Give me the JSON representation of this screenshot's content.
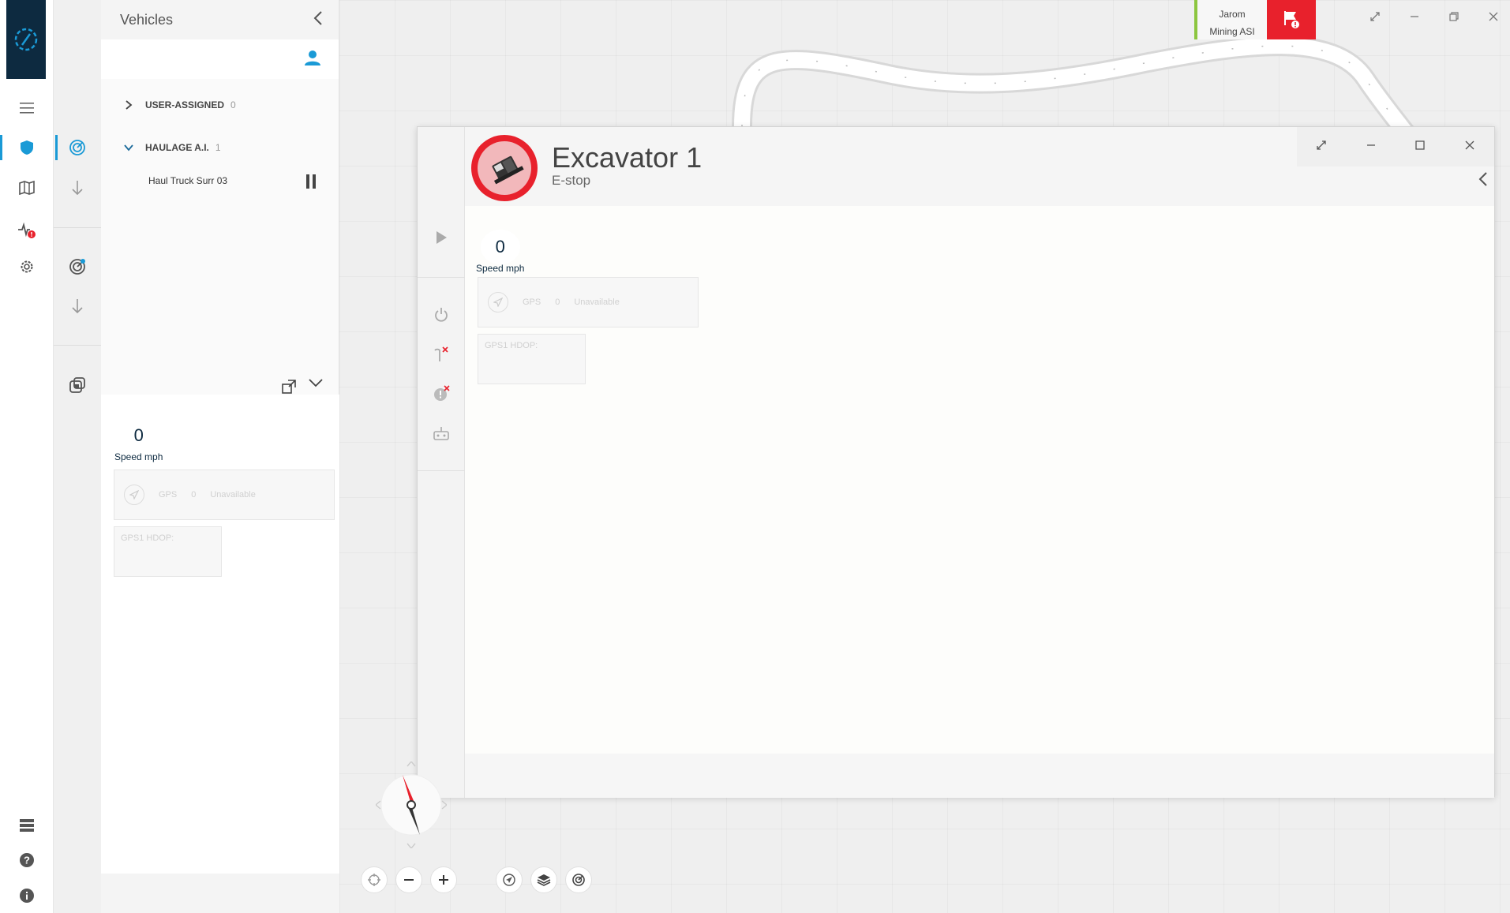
{
  "panel": {
    "title": "Vehicles",
    "groups": [
      {
        "label": "USER-ASSIGNED",
        "count": "0",
        "expanded": false
      },
      {
        "label": "HAULAGE A.I.",
        "count": "1",
        "expanded": true
      }
    ],
    "vehicles": [
      {
        "label": "Haul Truck Surr 03",
        "state": "paused"
      }
    ],
    "telemetry": {
      "speed_value": "0",
      "speed_label": "Speed mph",
      "gps_label": "GPS",
      "gps_value": "0",
      "gps_status": "Unavailable",
      "hdop_label": "GPS1 HDOP:"
    }
  },
  "user": {
    "name": "Jarom",
    "org": "Mining ASI"
  },
  "dialog": {
    "title": "Excavator 1",
    "subtitle": "E-stop",
    "telemetry": {
      "speed_value": "0",
      "speed_label": "Speed mph",
      "gps_label": "GPS",
      "gps_value": "0",
      "gps_status": "Unavailable",
      "hdop_label": "GPS1 HDOP:"
    }
  },
  "colors": {
    "accent": "#1a9ad6",
    "alert": "#e8212c",
    "nav_dark": "#0d2a40",
    "status_green": "#8cc63f"
  },
  "icons": {
    "rail": [
      "hamburger-menu-icon",
      "shield-icon",
      "map-icon",
      "activity-alert-icon",
      "gear-icon",
      "server-icon",
      "help-icon",
      "info-icon"
    ],
    "rail2": [
      "radar-icon",
      "arrow-down-icon",
      "radar-alert-icon",
      "arrow-down-icon",
      "lock-group-icon"
    ],
    "dialog_side": [
      "play-icon",
      "power-icon",
      "hook-x-icon",
      "alert-x-icon",
      "robot-icon"
    ]
  }
}
